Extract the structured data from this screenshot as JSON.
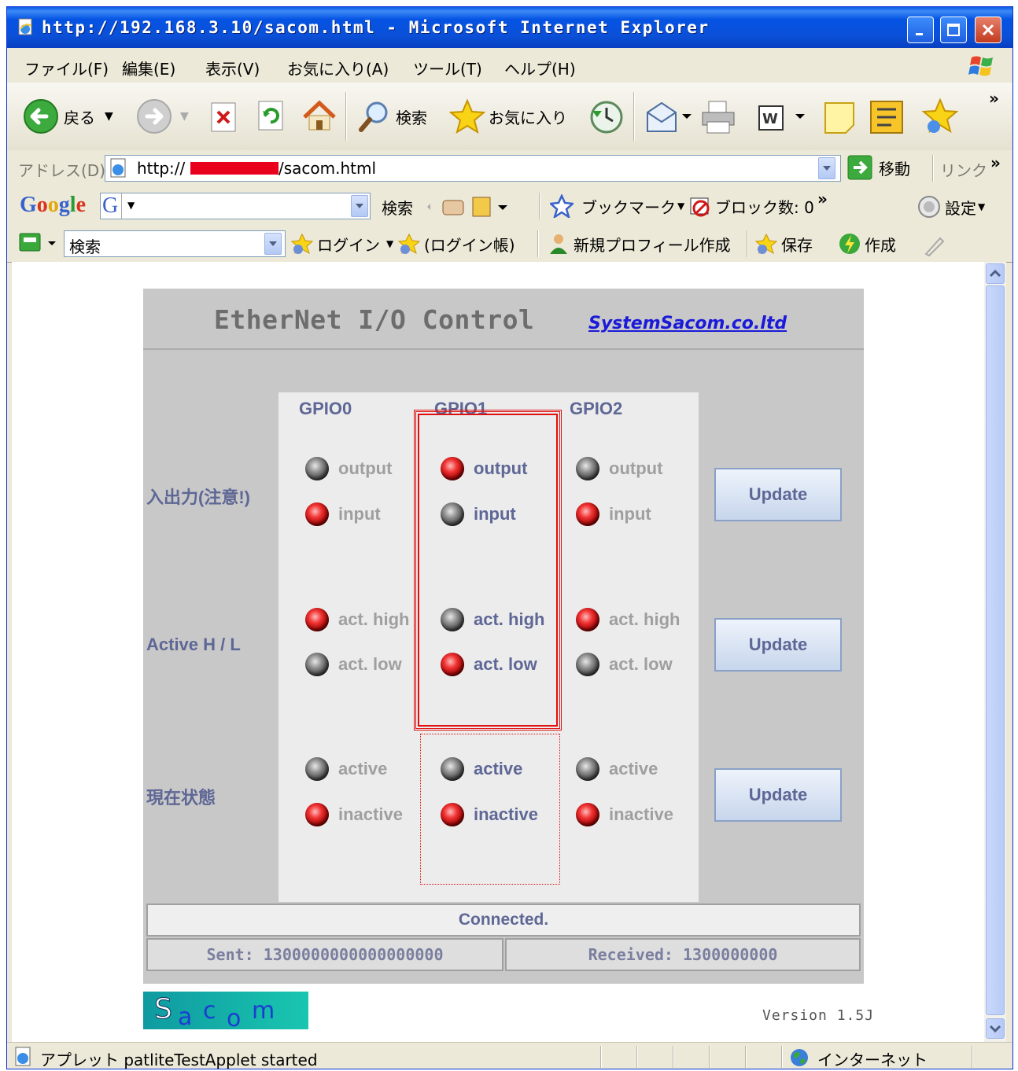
{
  "window": {
    "title": "http://192.168.3.10/sacom.html - Microsoft Internet Explorer"
  },
  "menu": [
    "ファイル(F)",
    "編集(E)",
    "表示(V)",
    "お気に入り(A)",
    "ツール(T)",
    "ヘルプ(H)"
  ],
  "toolbar": {
    "back": "戻る",
    "search": "検索",
    "favorites": "お気に入り",
    "chevron": "»"
  },
  "address": {
    "label": "アドレス(D)",
    "url_prefix": "http://",
    "url_suffix": "/sacom.html",
    "go": "移動",
    "links": "リンク",
    "chevron": "»"
  },
  "google_bar": {
    "logo": "Google",
    "search": "検索",
    "bookmarks": "ブックマーク",
    "blocked": "ブロック数: 0",
    "chevron": "»",
    "settings": "設定"
  },
  "search_bar": {
    "query": "検索",
    "login": "ログイン",
    "login_book": "(ログイン帳)",
    "new_profile": "新規プロフィール作成",
    "save": "保存",
    "create": "作成"
  },
  "applet": {
    "title": "EtherNet I/O Control",
    "company": "SystemSacom.co.ltd",
    "gpio_headers": [
      "GPIO0",
      "GPIO1",
      "GPIO2"
    ],
    "rows": [
      {
        "label": "入出力(注意!)",
        "options": [
          "output",
          "input"
        ],
        "selected": [
          "input",
          "output",
          "input"
        ],
        "enabled": [
          false,
          true,
          false
        ],
        "button": "Update"
      },
      {
        "label": "Active H / L",
        "options": [
          "act. high",
          "act. low"
        ],
        "selected": [
          "act. high",
          "act. low",
          "act. high"
        ],
        "enabled": [
          false,
          true,
          false
        ],
        "button": "Update"
      },
      {
        "label": "現在状態",
        "options": [
          "active",
          "inactive"
        ],
        "selected": [
          "inactive",
          "inactive",
          "inactive"
        ],
        "enabled": [
          false,
          true,
          false
        ],
        "button": "Update"
      }
    ],
    "status": "Connected.",
    "sent": "Sent: 1300000000000000000",
    "received": "Received: 1300000000",
    "logo": "Sacom",
    "version": "Version 1.5J"
  },
  "statusbar": {
    "message": "アプレット patliteTestApplet started",
    "zone": "インターネット"
  },
  "colors": {
    "titlebar": "#0553e3",
    "panel_text": "#5e6795",
    "selection_box": "#e01010",
    "company_link": "#1a1ad8"
  }
}
